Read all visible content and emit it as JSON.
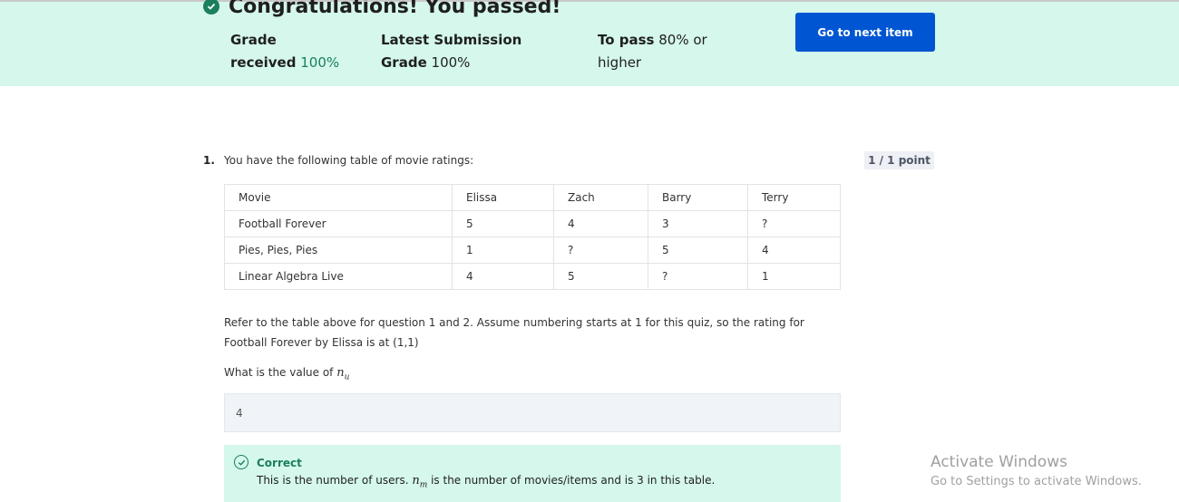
{
  "banner": {
    "title": "Congratulations! You passed!",
    "grade_label_1": "Grade",
    "grade_label_2": "received",
    "grade_value": "100%",
    "latest_label_1": "Latest Submission",
    "latest_label_2": "Grade",
    "latest_value": "100%",
    "pass_label": "To pass",
    "pass_value": "80% or",
    "pass_value_2": "higher",
    "next_button": "Go to next item"
  },
  "question": {
    "number": "1.",
    "prompt": "You have the following table of movie ratings:",
    "points": "1 / 1 point",
    "table": {
      "headers": [
        "Movie",
        "Elissa",
        "Zach",
        "Barry",
        "Terry"
      ],
      "rows": [
        [
          "Football Forever",
          "5",
          "4",
          "3",
          "?"
        ],
        [
          "Pies, Pies, Pies",
          "1",
          "?",
          "5",
          "4"
        ],
        [
          "Linear Algebra Live",
          "4",
          "5",
          "?",
          "1"
        ]
      ]
    },
    "paragraph": "Refer to the table above for question 1 and 2. Assume numbering starts at 1 for this quiz, so the rating for Football Forever by Elissa is at (1,1)",
    "ask_prefix": "What is the value of",
    "ask_var": "n",
    "ask_sub": "u",
    "answer": "4",
    "feedback": {
      "title": "Correct",
      "text_prefix": "This is the number of users.",
      "var": "n",
      "sub": "m",
      "text_suffix": "is the number of movies/items and is 3 in this table."
    }
  },
  "watermark": {
    "line1": "Activate Windows",
    "line2": "Go to Settings to activate Windows."
  },
  "colors": {
    "banner_bg": "#d5f7ec",
    "accent_green": "#1b7f5c",
    "button_blue": "#0056d2"
  }
}
